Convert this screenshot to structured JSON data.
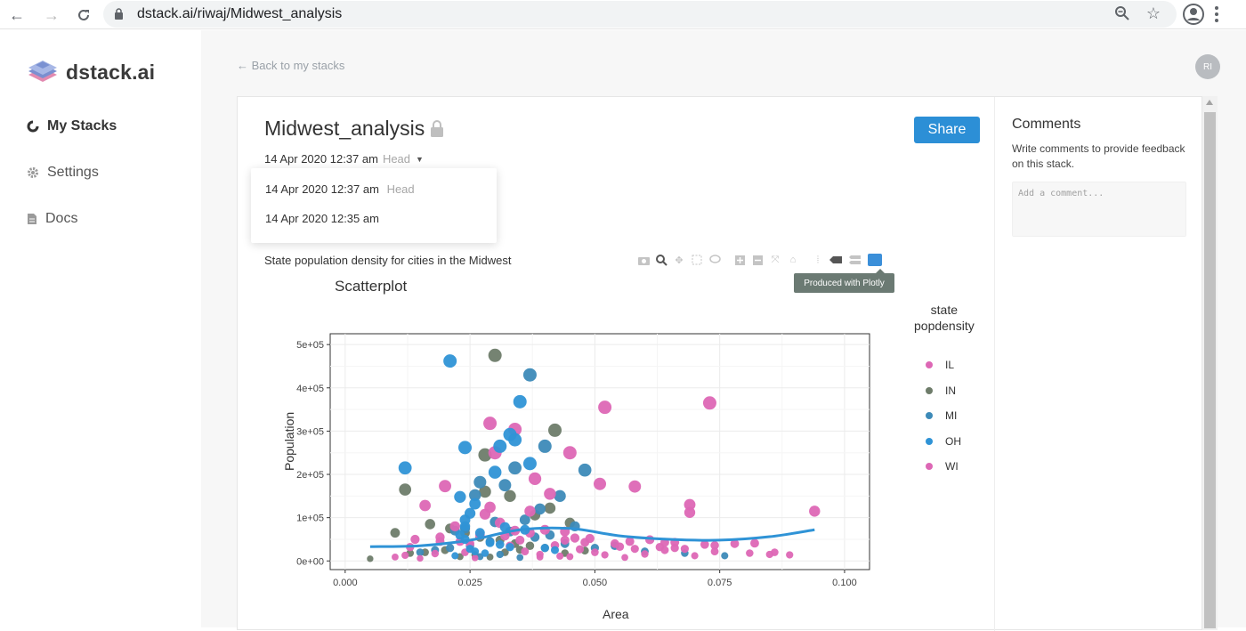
{
  "browser": {
    "url": "dstack.ai/riwaj/Midwest_analysis"
  },
  "sidebar": {
    "brand": "dstack.ai",
    "items": [
      {
        "label": "My Stacks"
      },
      {
        "label": "Settings"
      },
      {
        "label": "Docs"
      }
    ]
  },
  "header": {
    "back_label": "← Back to my stacks",
    "avatar_initials": "RI"
  },
  "stack": {
    "title": "Midwest_analysis",
    "current_revision": "14 Apr 2020 12:37 am",
    "head_tag": "Head",
    "share_label": "Share",
    "revisions": [
      {
        "date": "14 Apr 2020 12:37 am",
        "tag": "Head"
      },
      {
        "date": "14 Apr 2020 12:35 am",
        "tag": ""
      }
    ],
    "caption": "State population density for cities in the Midwest"
  },
  "plot_ui": {
    "tooltip": "Produced with Plotly",
    "modebar_icons": [
      "camera-icon",
      "zoom-icon",
      "pan-icon",
      "box-select-icon",
      "lasso-icon",
      "zoom-in-icon",
      "zoom-out-icon",
      "autoscale-icon",
      "reset-icon",
      "spike-icon",
      "hover-closest-icon",
      "hover-compare-icon",
      "plotly-logo-icon"
    ]
  },
  "comments": {
    "title": "Comments",
    "description": "Write comments to provide feedback on this stack.",
    "placeholder": "Add a comment..."
  },
  "chart_data": {
    "type": "scatter",
    "title": "Scatterplot",
    "xlabel": "Area",
    "ylabel": "Population",
    "xlim": [
      -0.003,
      0.105
    ],
    "ylim": [
      -20000,
      525000
    ],
    "xticks": [
      "0.000",
      "0.025",
      "0.050",
      "0.075",
      "0.100"
    ],
    "yticks": [
      "0e+00",
      "1e+05",
      "2e+05",
      "3e+05",
      "4e+05",
      "5e+05"
    ],
    "grid": true,
    "legend_title": [
      "state",
      "popdensity"
    ],
    "legend_position": "right",
    "colors": {
      "IL": "#dd67b5",
      "IN": "#6e7c6a",
      "MI": "#3d8ab8",
      "OH": "#2f93d6",
      "WI": "#dd67b5"
    },
    "series": [
      {
        "name": "IL",
        "points": [
          [
            0.073,
            365000
          ],
          [
            0.052,
            355000
          ],
          [
            0.029,
            318000
          ],
          [
            0.034,
            304000
          ],
          [
            0.045,
            250000
          ],
          [
            0.03,
            250000
          ],
          [
            0.02,
            173000
          ],
          [
            0.051,
            178000
          ],
          [
            0.058,
            172000
          ],
          [
            0.038,
            190000
          ],
          [
            0.041,
            155000
          ],
          [
            0.069,
            130000
          ],
          [
            0.069,
            112000
          ],
          [
            0.016,
            128000
          ],
          [
            0.029,
            124000
          ],
          [
            0.037,
            115000
          ],
          [
            0.094,
            115000
          ],
          [
            0.061,
            49000
          ],
          [
            0.064,
            43000
          ],
          [
            0.078,
            40000
          ],
          [
            0.082,
            41000
          ],
          [
            0.074,
            36000
          ],
          [
            0.089,
            14000
          ],
          [
            0.066,
            30000
          ],
          [
            0.055,
            33000
          ],
          [
            0.047,
            27000
          ],
          [
            0.036,
            22000
          ],
          [
            0.024,
            20000
          ],
          [
            0.018,
            17000
          ],
          [
            0.012,
            13000
          ],
          [
            0.043,
            11000
          ],
          [
            0.052,
            14000
          ],
          [
            0.06,
            16000
          ],
          [
            0.07,
            12000
          ],
          [
            0.085,
            15000
          ],
          [
            0.033,
            35000
          ],
          [
            0.027,
            60000
          ],
          [
            0.022,
            80000
          ],
          [
            0.046,
            53000
          ],
          [
            0.04,
            72000
          ],
          [
            0.031,
            88000
          ],
          [
            0.028,
            108000
          ],
          [
            0.044,
            68000
          ],
          [
            0.05,
            20000
          ],
          [
            0.056,
            8000
          ],
          [
            0.039,
            9000
          ],
          [
            0.026,
            7000
          ],
          [
            0.015,
            6000
          ],
          [
            0.01,
            9000
          ],
          [
            0.064,
            25000
          ],
          [
            0.058,
            28000
          ],
          [
            0.054,
            40000
          ],
          [
            0.048,
            43000
          ],
          [
            0.042,
            36000
          ],
          [
            0.035,
            48000
          ],
          [
            0.032,
            58000
          ],
          [
            0.025,
            40000
          ],
          [
            0.019,
            45000
          ],
          [
            0.013,
            32000
          ],
          [
            0.066,
            43000
          ],
          [
            0.072,
            38000
          ]
        ]
      },
      {
        "name": "IN",
        "points": [
          [
            0.03,
            475000
          ],
          [
            0.042,
            302000
          ],
          [
            0.028,
            245000
          ],
          [
            0.012,
            165000
          ],
          [
            0.028,
            160000
          ],
          [
            0.033,
            150000
          ],
          [
            0.041,
            122000
          ],
          [
            0.038,
            106000
          ],
          [
            0.045,
            88000
          ],
          [
            0.01,
            65000
          ],
          [
            0.017,
            85000
          ],
          [
            0.021,
            75000
          ],
          [
            0.024,
            65000
          ],
          [
            0.027,
            55000
          ],
          [
            0.031,
            48000
          ],
          [
            0.034,
            40000
          ],
          [
            0.037,
            35000
          ],
          [
            0.04,
            30000
          ],
          [
            0.02,
            25000
          ],
          [
            0.016,
            20000
          ],
          [
            0.013,
            18000
          ],
          [
            0.005,
            5000
          ],
          [
            0.023,
            10000
          ],
          [
            0.026,
            14000
          ],
          [
            0.029,
            9000
          ],
          [
            0.032,
            20000
          ],
          [
            0.035,
            26000
          ],
          [
            0.044,
            18000
          ],
          [
            0.048,
            24000
          ]
        ]
      },
      {
        "name": "MI",
        "points": [
          [
            0.037,
            430000
          ],
          [
            0.04,
            265000
          ],
          [
            0.034,
            215000
          ],
          [
            0.048,
            210000
          ],
          [
            0.027,
            182000
          ],
          [
            0.032,
            175000
          ],
          [
            0.026,
            152000
          ],
          [
            0.043,
            150000
          ],
          [
            0.039,
            120000
          ],
          [
            0.036,
            95000
          ],
          [
            0.03,
            90000
          ],
          [
            0.046,
            80000
          ],
          [
            0.024,
            75000
          ],
          [
            0.022,
            70000
          ],
          [
            0.033,
            68000
          ],
          [
            0.029,
            45000
          ],
          [
            0.025,
            35000
          ],
          [
            0.021,
            30000
          ],
          [
            0.018,
            25000
          ],
          [
            0.015,
            20000
          ],
          [
            0.041,
            60000
          ],
          [
            0.038,
            55000
          ],
          [
            0.044,
            40000
          ],
          [
            0.05,
            30000
          ],
          [
            0.054,
            35000
          ],
          [
            0.06,
            22000
          ],
          [
            0.068,
            18000
          ],
          [
            0.076,
            12000
          ],
          [
            0.031,
            15000
          ],
          [
            0.027,
            10000
          ],
          [
            0.035,
            8000
          ]
        ]
      },
      {
        "name": "OH",
        "points": [
          [
            0.021,
            462000
          ],
          [
            0.035,
            368000
          ],
          [
            0.033,
            292000
          ],
          [
            0.034,
            280000
          ],
          [
            0.031,
            265000
          ],
          [
            0.024,
            262000
          ],
          [
            0.012,
            215000
          ],
          [
            0.037,
            225000
          ],
          [
            0.03,
            205000
          ],
          [
            0.023,
            148000
          ],
          [
            0.026,
            132000
          ],
          [
            0.025,
            110000
          ],
          [
            0.024,
            95000
          ],
          [
            0.024,
            80000
          ],
          [
            0.032,
            78000
          ],
          [
            0.036,
            72000
          ],
          [
            0.027,
            65000
          ],
          [
            0.023,
            60000
          ],
          [
            0.024,
            50000
          ],
          [
            0.029,
            42000
          ],
          [
            0.031,
            38000
          ],
          [
            0.033,
            32000
          ],
          [
            0.025,
            28000
          ],
          [
            0.026,
            22000
          ],
          [
            0.028,
            18000
          ],
          [
            0.022,
            12000
          ],
          [
            0.04,
            30000
          ],
          [
            0.042,
            25000
          ]
        ]
      },
      {
        "name": "WI",
        "points": [
          [
            0.014,
            50000
          ],
          [
            0.019,
            55000
          ],
          [
            0.023,
            45000
          ],
          [
            0.034,
            70000
          ],
          [
            0.037,
            65000
          ],
          [
            0.044,
            48000
          ],
          [
            0.049,
            52000
          ],
          [
            0.057,
            45000
          ],
          [
            0.063,
            32000
          ],
          [
            0.068,
            28000
          ],
          [
            0.074,
            22000
          ],
          [
            0.081,
            18000
          ],
          [
            0.086,
            20000
          ],
          [
            0.039,
            15000
          ],
          [
            0.045,
            10000
          ]
        ]
      }
    ],
    "trend": {
      "name": "smooth",
      "color": "#2f93d6",
      "points": [
        [
          0.005,
          33000
        ],
        [
          0.015,
          35000
        ],
        [
          0.025,
          48000
        ],
        [
          0.035,
          72000
        ],
        [
          0.045,
          75000
        ],
        [
          0.055,
          58000
        ],
        [
          0.065,
          50000
        ],
        [
          0.075,
          48000
        ],
        [
          0.085,
          56000
        ],
        [
          0.094,
          72000
        ]
      ]
    }
  }
}
